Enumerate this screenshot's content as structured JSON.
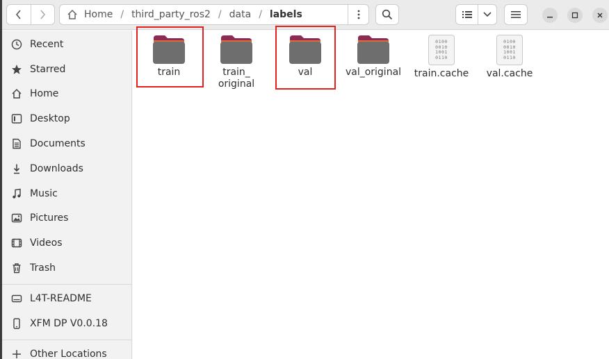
{
  "header": {
    "path": [
      "Home",
      "third_party_ros2",
      "data",
      "labels"
    ]
  },
  "sidebar": {
    "items": [
      {
        "label": "Recent",
        "icon": "clock-icon"
      },
      {
        "label": "Starred",
        "icon": "star-icon"
      },
      {
        "label": "Home",
        "icon": "home-icon"
      },
      {
        "label": "Desktop",
        "icon": "desktop-icon"
      },
      {
        "label": "Documents",
        "icon": "documents-icon"
      },
      {
        "label": "Downloads",
        "icon": "download-icon"
      },
      {
        "label": "Music",
        "icon": "music-icon"
      },
      {
        "label": "Pictures",
        "icon": "pictures-icon"
      },
      {
        "label": "Videos",
        "icon": "videos-icon"
      },
      {
        "label": "Trash",
        "icon": "trash-icon"
      }
    ],
    "devices": [
      {
        "label": "L4T-README",
        "icon": "drive-icon"
      },
      {
        "label": "XFM DP V0.0.18",
        "icon": "phone-icon"
      }
    ],
    "other_locations": "Other Locations"
  },
  "files": [
    {
      "name": "train",
      "type": "folder",
      "highlighted": true
    },
    {
      "name": "train_\noriginal",
      "type": "folder",
      "highlighted": false
    },
    {
      "name": "val",
      "type": "folder",
      "highlighted": true
    },
    {
      "name": "val_original",
      "type": "folder",
      "highlighted": false
    },
    {
      "name": "train.cache",
      "type": "binary",
      "highlighted": false
    },
    {
      "name": "val.cache",
      "type": "binary",
      "highlighted": false
    }
  ],
  "binary_icon_text": [
    "0100",
    "0010",
    "1001",
    "0110"
  ],
  "colors": {
    "folder_body": "#6e6e6e",
    "folder_tab": "#8d2b52",
    "folder_accent": "#e06a3b",
    "highlight": "#e3201b"
  }
}
